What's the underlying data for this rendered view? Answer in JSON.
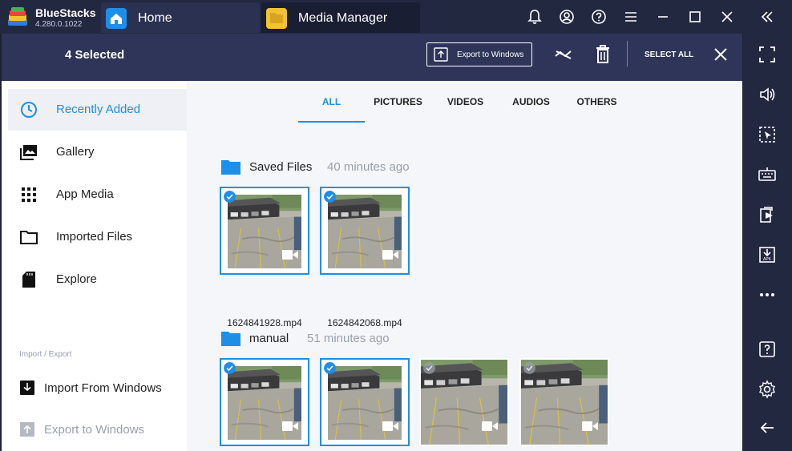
{
  "app": {
    "name": "BlueStacks",
    "version": "4.280.0.1022"
  },
  "tabs": [
    {
      "label": "Home",
      "icon": "home-icon",
      "color": "#1f8ee6"
    },
    {
      "label": "Media Manager",
      "icon": "folder-icon",
      "color": "#f1c232"
    }
  ],
  "toolbar": {
    "selected_label": "4 Selected",
    "export_label": "Export to Windows",
    "select_all_label": "SELECT ALL"
  },
  "nav": [
    {
      "label": "Recently Added",
      "icon": "clock-icon",
      "active": true
    },
    {
      "label": "Gallery",
      "icon": "gallery-icon",
      "active": false
    },
    {
      "label": "App Media",
      "icon": "grid-icon",
      "active": false
    },
    {
      "label": "Imported Files",
      "icon": "folder-outline-icon",
      "active": false
    },
    {
      "label": "Explore",
      "icon": "sd-card-icon",
      "active": false
    }
  ],
  "import_export": {
    "section_label": "Import / Export",
    "import_label": "Import From Windows",
    "export_label": "Export to Windows"
  },
  "content_tabs": [
    "ALL",
    "PICTURES",
    "VIDEOS",
    "AUDIOS",
    "OTHERS"
  ],
  "active_content_tab": "ALL",
  "groups": [
    {
      "folder": "Saved Files",
      "time": "40 minutes ago",
      "files": [
        {
          "name": "1624841928.mp4",
          "selected": true
        },
        {
          "name": "1624842068.mp4",
          "selected": true
        }
      ]
    },
    {
      "folder": "manual",
      "time": "51 minutes ago",
      "files": [
        {
          "name": "",
          "selected": true
        },
        {
          "name": "",
          "selected": true
        },
        {
          "name": "",
          "selected": false
        },
        {
          "name": "",
          "selected": false
        }
      ]
    }
  ],
  "colors": {
    "accent": "#1f8ee6",
    "appbar": "#2e3558",
    "titlebar": "#232841"
  }
}
